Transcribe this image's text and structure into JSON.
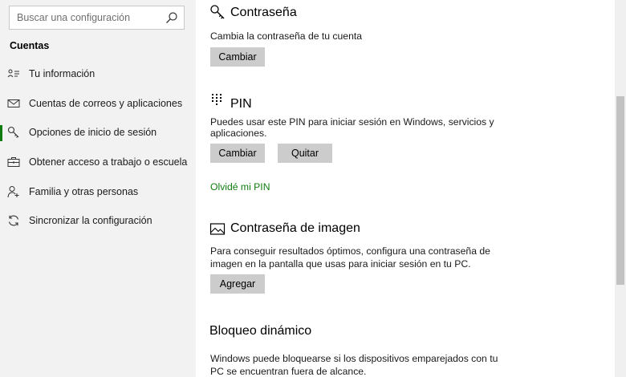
{
  "search": {
    "placeholder": "Buscar una configuración",
    "icon": "search-icon"
  },
  "sidebar": {
    "section_title": "Cuentas",
    "items": [
      {
        "label": "Tu información",
        "icon": "person-card-icon",
        "active": false
      },
      {
        "label": "Cuentas de correos y aplicaciones",
        "icon": "mail-icon",
        "active": false
      },
      {
        "label": "Opciones de inicio de sesión",
        "icon": "key-icon",
        "active": true
      },
      {
        "label": "Obtener acceso a trabajo o escuela",
        "icon": "briefcase-icon",
        "active": false
      },
      {
        "label": "Familia y otras personas",
        "icon": "person-add-icon",
        "active": false
      },
      {
        "label": "Sincronizar la configuración",
        "icon": "sync-icon",
        "active": false
      }
    ]
  },
  "main": {
    "password": {
      "title": "Contraseña",
      "description": "Cambia la contraseña de tu cuenta",
      "change_button": "Cambiar"
    },
    "pin": {
      "title": "PIN",
      "description_line1": "Puedes usar este PIN para iniciar sesión en Windows, servicios y",
      "description_line2": "aplicaciones.",
      "change_button": "Cambiar",
      "remove_button": "Quitar",
      "forgot_link": "Olvidé mi PIN"
    },
    "picture_password": {
      "title": "Contraseña de imagen",
      "description_line1": "Para conseguir resultados óptimos, configura una contraseña de",
      "description_line2": "imagen en la pantalla que usas para iniciar sesión en tu PC.",
      "add_button": "Agregar"
    },
    "dynamic_lock": {
      "title": "Bloqueo dinámico",
      "description_line1": "Windows puede bloquearse si los dispositivos emparejados con tu",
      "description_line2": "PC se encuentran fuera de alcance."
    }
  },
  "colors": {
    "accent": "#107c10",
    "sidebar_bg": "#f2f2f2",
    "button_bg": "#cccccc"
  }
}
